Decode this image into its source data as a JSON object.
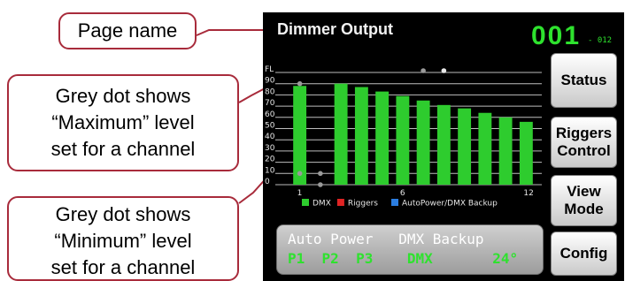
{
  "callouts": {
    "page_name": "Page name",
    "max_lines": [
      "Grey dot shows",
      "“Maximum” level",
      "set for a channel"
    ],
    "min_lines": [
      "Grey dot shows",
      "“Minimum” level",
      "set for a channel"
    ]
  },
  "header": {
    "page_title": "Dimmer Output",
    "device_number": "001",
    "device_sub": "- 012"
  },
  "buttons": {
    "status": "Status",
    "riggers_line1": "Riggers",
    "riggers_line2": "Control",
    "view_line1": "View",
    "view_line2": "Mode",
    "config": "Config"
  },
  "status_panel": {
    "autopower_label": "Auto Power",
    "dmx_backup_label": "DMX Backup",
    "p1": "P1",
    "p2": "P2",
    "p3": "P3",
    "dmx_value": "DMX",
    "temperature": "24°"
  },
  "chart_data": {
    "type": "bar",
    "categories": [
      "1",
      "2",
      "3",
      "4",
      "5",
      "6",
      "7",
      "8",
      "9",
      "10",
      "11",
      "12"
    ],
    "x_tick_labels": [
      "1",
      "6",
      "12"
    ],
    "y_tick_labels": [
      "FL",
      "90",
      "80",
      "70",
      "60",
      "50",
      "40",
      "30",
      "20",
      "10",
      "0"
    ],
    "ylim": [
      0,
      100
    ],
    "grid": true,
    "series": [
      {
        "name": "DMX",
        "color": "#2ecc2e",
        "values": [
          88,
          0,
          90,
          87,
          83,
          79,
          75,
          71,
          68,
          64,
          60,
          56
        ]
      }
    ],
    "max_markers": [
      {
        "channel": 1,
        "value": 90
      },
      {
        "channel": 7,
        "value": 100
      },
      {
        "channel": 8,
        "value": 100
      }
    ],
    "min_markers": [
      {
        "channel": 1,
        "value": 10
      },
      {
        "channel": 2,
        "value": 10
      },
      {
        "channel": 2,
        "value": 0
      }
    ],
    "legend": [
      {
        "label": "DMX",
        "color": "#2ecc2e"
      },
      {
        "label": "Riggers",
        "color": "#e02424"
      },
      {
        "label": "AutoPower/DMX Backup",
        "color": "#2b7de0"
      }
    ],
    "legend_position": "bottom"
  },
  "colors": {
    "accent_green": "#2ee22e",
    "callout_border": "#a82b3b",
    "screen_background": "#000000"
  }
}
